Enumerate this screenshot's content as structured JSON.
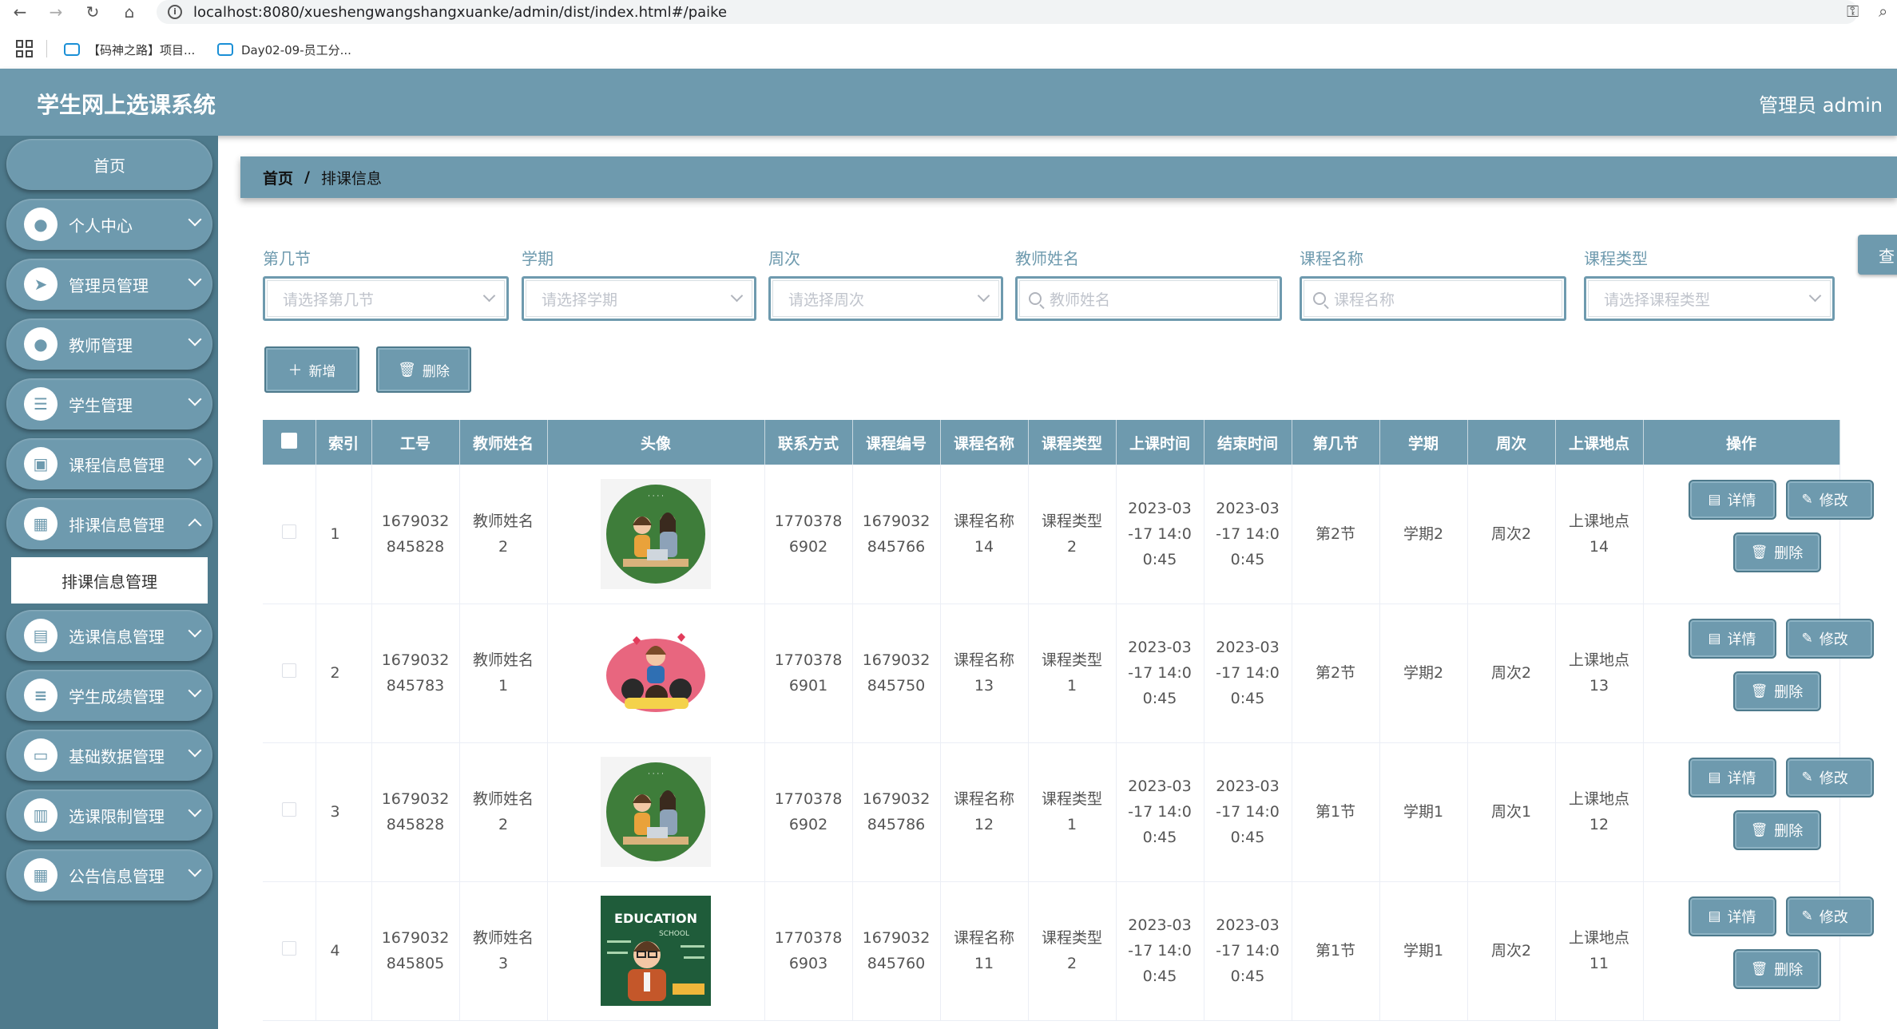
{
  "browser": {
    "url": "localhost:8080/xueshengwangshangxuanke/admin/dist/index.html#/paike",
    "bookmarks": [
      "【码神之路】项目...",
      "Day02-09-员工分..."
    ]
  },
  "header": {
    "title": "学生网上选课系统",
    "user": "管理员 admin"
  },
  "sidebar": {
    "home": "首页",
    "items": [
      {
        "label": "个人中心",
        "icon": "user-icon"
      },
      {
        "label": "管理员管理",
        "icon": "send-icon"
      },
      {
        "label": "教师管理",
        "icon": "user-icon"
      },
      {
        "label": "学生管理",
        "icon": "list-icon"
      },
      {
        "label": "课程信息管理",
        "icon": "briefcase-icon"
      },
      {
        "label": "排课信息管理",
        "icon": "grid-icon"
      },
      {
        "label": "选课信息管理",
        "icon": "document-icon"
      },
      {
        "label": "学生成绩管理",
        "icon": "sliders-icon"
      },
      {
        "label": "基础数据管理",
        "icon": "chat-icon"
      },
      {
        "label": "选课限制管理",
        "icon": "book-icon"
      },
      {
        "label": "公告信息管理",
        "icon": "grid-icon"
      }
    ],
    "submenu": "排课信息管理"
  },
  "breadcrumb": {
    "home": "首页",
    "sep": "/",
    "current": "排课信息"
  },
  "search": {
    "fields": [
      {
        "label": "第几节",
        "placeholder": "请选择第几节"
      },
      {
        "label": "学期",
        "placeholder": "请选择学期"
      },
      {
        "label": "周次",
        "placeholder": "请选择周次"
      },
      {
        "label": "教师姓名",
        "placeholder": "教师姓名"
      },
      {
        "label": "课程名称",
        "placeholder": "课程名称"
      },
      {
        "label": "课程类型",
        "placeholder": "请选择课程类型"
      }
    ],
    "query_label": "查"
  },
  "actions": {
    "add": "新增",
    "delete": "删除"
  },
  "table": {
    "headers": [
      "索引",
      "工号",
      "教师姓名",
      "头像",
      "联系方式",
      "课程编号",
      "课程名称",
      "课程类型",
      "上课时间",
      "结束时间",
      "第几节",
      "学期",
      "周次",
      "上课地点",
      "操作"
    ],
    "rows": [
      {
        "idx": "1",
        "gonghao": "1679032\n845828",
        "teacher": "教师姓名\n2",
        "contact": "1770378\n6902",
        "code": "1679032\n845766",
        "course": "课程名称\n14",
        "type": "课程类型\n2",
        "start": "2023-03\n-17 14:0\n0:45",
        "end": "2023-03\n-17 14:0\n0:45",
        "section": "第2节",
        "term": "学期2",
        "week": "周次2",
        "place": "上课地点\n14",
        "avatar": "teacher-laptop"
      },
      {
        "idx": "2",
        "gonghao": "1679032\n845783",
        "teacher": "教师姓名\n1",
        "contact": "1770378\n6901",
        "code": "1679032\n845750",
        "course": "课程名称\n13",
        "type": "课程类型\n1",
        "start": "2023-03\n-17 14:0\n0:45",
        "end": "2023-03\n-17 14:0\n0:45",
        "section": "第2节",
        "term": "学期2",
        "week": "周次2",
        "place": "上课地点\n13",
        "avatar": "teacher-kids"
      },
      {
        "idx": "3",
        "gonghao": "1679032\n845828",
        "teacher": "教师姓名\n2",
        "contact": "1770378\n6902",
        "code": "1679032\n845786",
        "course": "课程名称\n12",
        "type": "课程类型\n1",
        "start": "2023-03\n-17 14:0\n0:45",
        "end": "2023-03\n-17 14:0\n0:45",
        "section": "第1节",
        "term": "学期1",
        "week": "周次1",
        "place": "上课地点\n12",
        "avatar": "teacher-laptop"
      },
      {
        "idx": "4",
        "gonghao": "1679032\n845805",
        "teacher": "教师姓名\n3",
        "contact": "1770378\n6903",
        "code": "1679032\n845760",
        "course": "课程名称\n11",
        "type": "课程类型\n2",
        "start": "2023-03\n-17 14:0\n0:45",
        "end": "2023-03\n-17 14:0\n0:45",
        "section": "第1节",
        "term": "学期1",
        "week": "周次2",
        "place": "上课地点\n11",
        "avatar": "education-board"
      }
    ],
    "row_buttons": {
      "detail": "详情",
      "edit": "修改",
      "delete": "删除"
    }
  },
  "avatar_art": {
    "education_text": "EDUCATION",
    "school_text": "SCHOOL"
  }
}
